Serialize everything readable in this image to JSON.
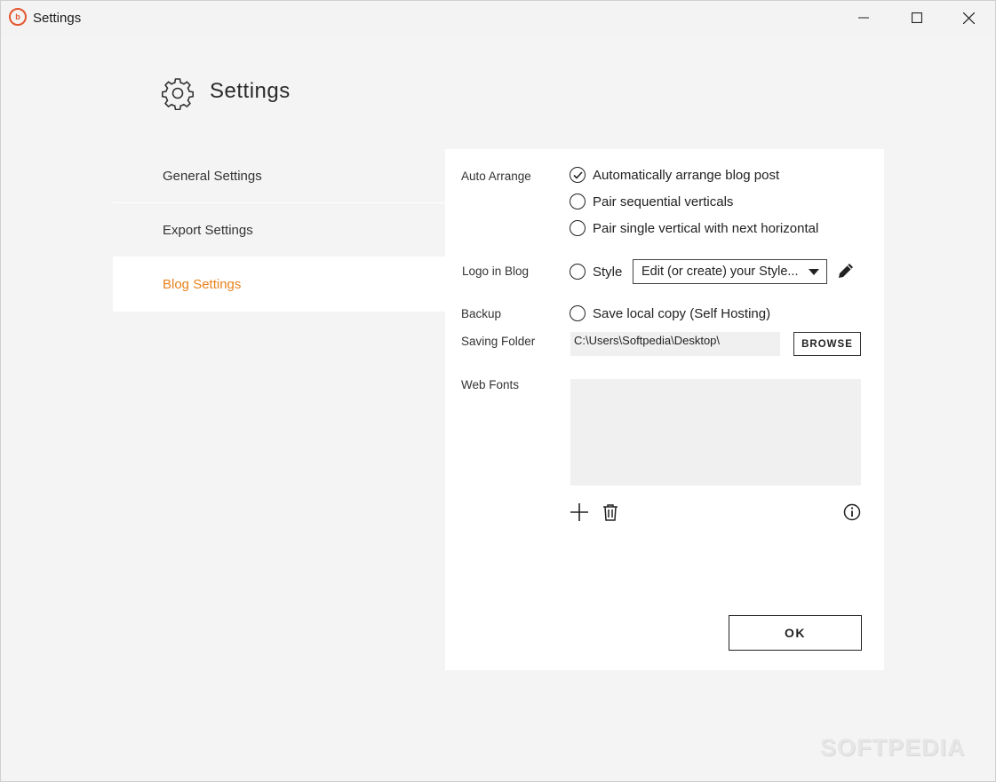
{
  "window": {
    "title": "Settings",
    "accent_color": "#e4572e",
    "app_icon_glyph": "b"
  },
  "header": {
    "title": "Settings",
    "icon": "gear-icon"
  },
  "nav": {
    "items": [
      {
        "label": "General Settings",
        "active": false
      },
      {
        "label": "Export Settings",
        "active": false
      },
      {
        "label": "Blog Settings",
        "active": true
      }
    ],
    "active_color": "#e8821c"
  },
  "blog": {
    "auto_arrange": {
      "label": "Auto Arrange",
      "options": [
        {
          "label": "Automatically arrange blog post",
          "checked": true
        },
        {
          "label": "Pair sequential verticals",
          "checked": false
        },
        {
          "label": "Pair single vertical with next horizontal",
          "checked": false
        }
      ]
    },
    "logo": {
      "label": "Logo in Blog",
      "style_option": "Style",
      "dropdown_value": "Edit (or create) your Style..."
    },
    "backup": {
      "label": "Backup",
      "option": "Save local copy (Self Hosting)"
    },
    "saving_folder": {
      "label": "Saving Folder",
      "value": "C:\\Users\\Softpedia\\Desktop\\",
      "browse_label": "BROWSE"
    },
    "web_fonts": {
      "label": "Web Fonts"
    },
    "ok_label": "OK"
  },
  "watermark": "SOFTPEDIA"
}
